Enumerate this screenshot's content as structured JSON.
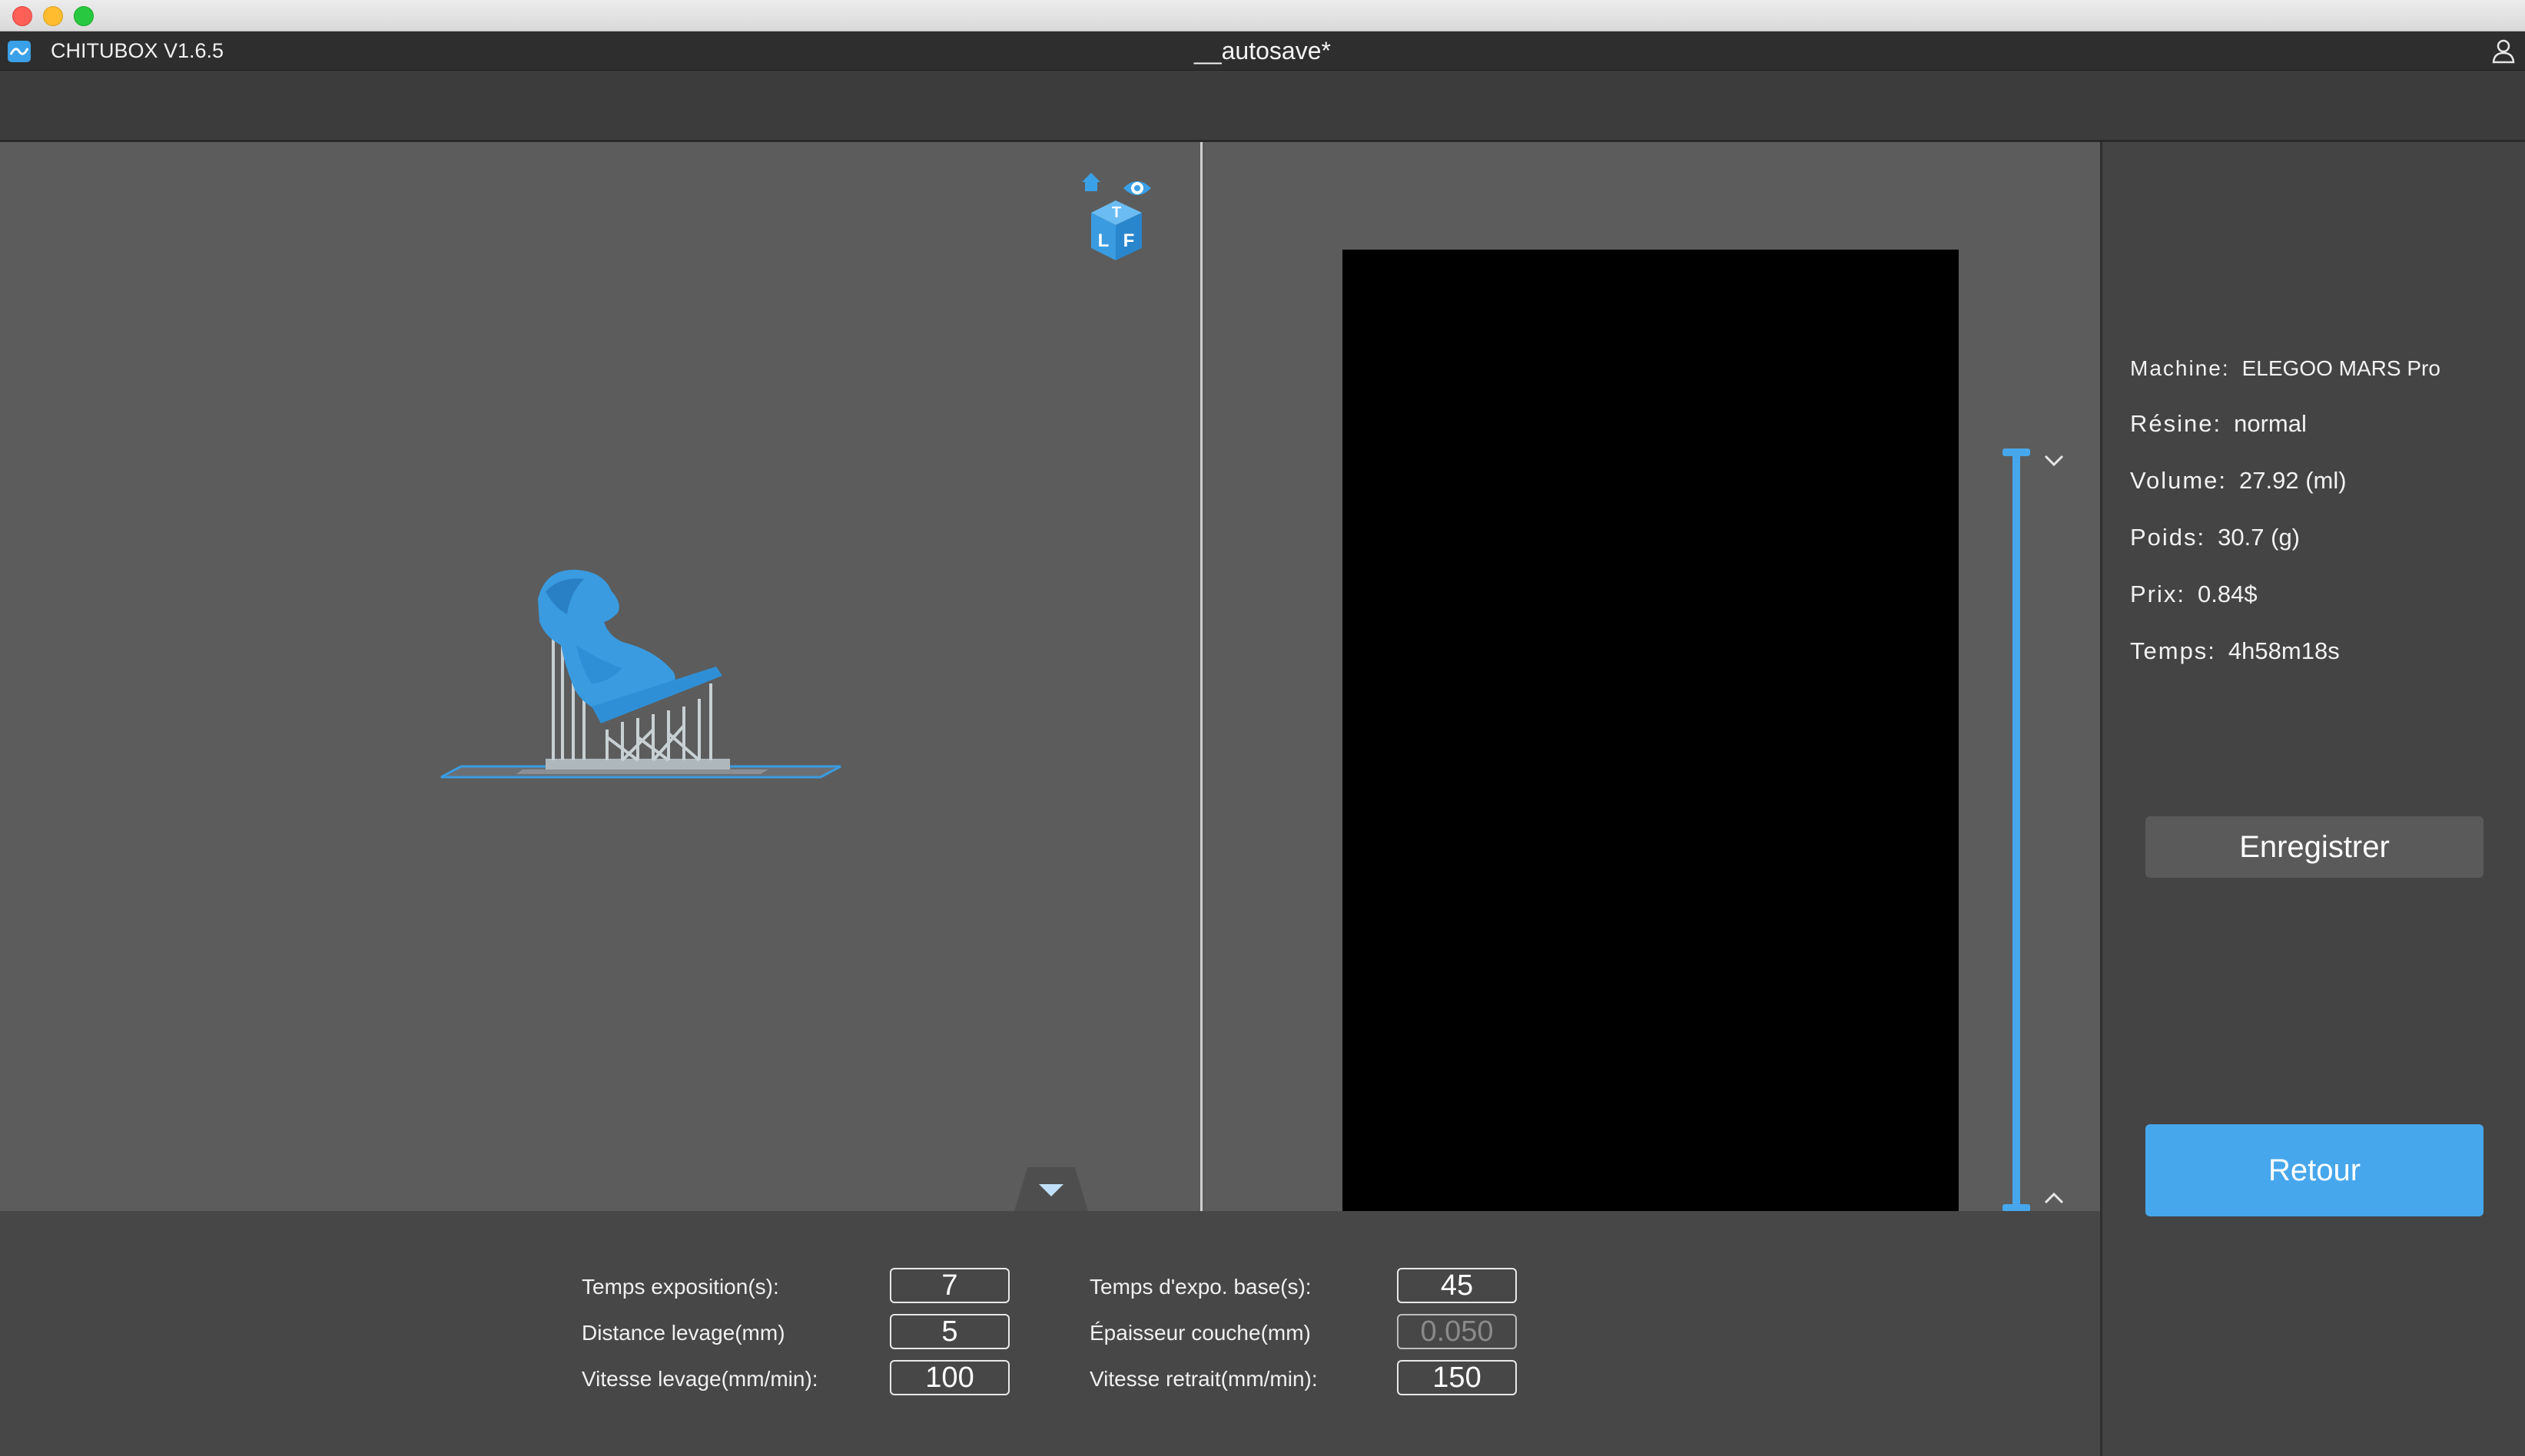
{
  "app": {
    "name": "CHITUBOX V1.6.5",
    "document_title": "__autosave*"
  },
  "info": {
    "machine_label": "Machine:",
    "machine_value": "ELEGOO MARS Pro",
    "resin_label": "Résine:",
    "resin_value": "normal",
    "volume_label": "Volume:",
    "volume_value": "27.92  (ml)",
    "weight_label": "Poids:",
    "weight_value": "30.7  (g)",
    "price_label": "Prix:",
    "price_value": "0.84$",
    "time_label": "Temps:",
    "time_value": "4h58m18s"
  },
  "buttons": {
    "save": "Enregistrer",
    "back": "Retour"
  },
  "params": {
    "exposure_time_label": "Temps exposition(s):",
    "exposure_time_value": "7",
    "lift_distance_label": "Distance levage(mm)",
    "lift_distance_value": "5",
    "lift_speed_label": "Vitesse levage(mm/min):",
    "lift_speed_value": "100",
    "bottom_exposure_label": "Temps d'expo. base(s):",
    "bottom_exposure_value": "45",
    "layer_thickness_label": "Épaisseur couche(mm)",
    "layer_thickness_value": "0.050",
    "retract_speed_label": "Vitesse retrait(mm/min):",
    "retract_speed_value": "150"
  },
  "view_cube": {
    "faces": [
      "T",
      "L",
      "F"
    ]
  },
  "colors": {
    "accent": "#47a7ec",
    "model": "#3a9be0",
    "viewport": "#5c5c5c"
  }
}
